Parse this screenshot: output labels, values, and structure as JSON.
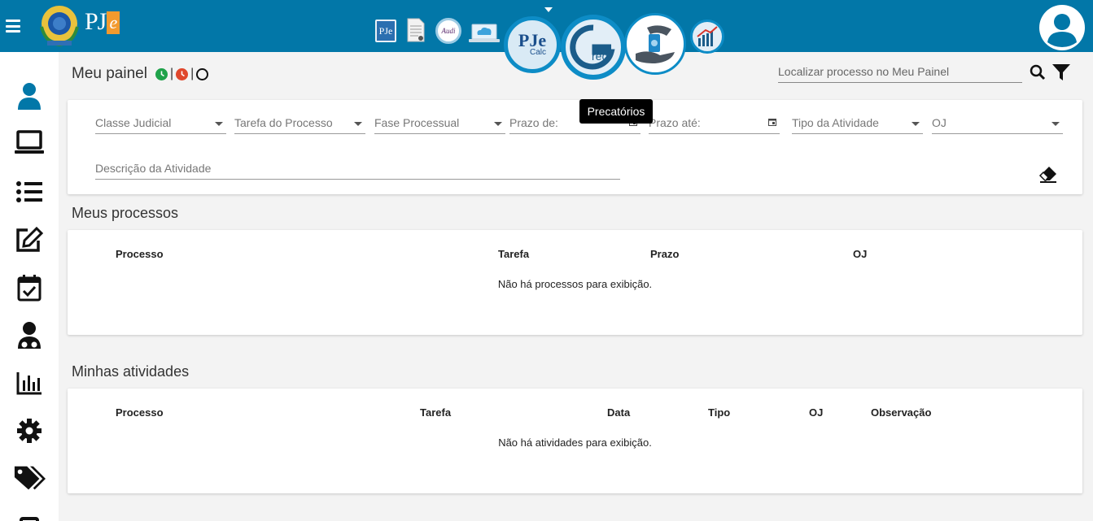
{
  "topbar": {
    "menu_icon": "hamburger-menu-icon",
    "brand_logo": "PJe",
    "apps": [
      {
        "name": "PJe",
        "icon": "pje-app-icon"
      },
      {
        "name": "Document",
        "icon": "document-icon"
      },
      {
        "name": "Audi",
        "icon": "audiencia-icon"
      },
      {
        "name": "Cloud",
        "icon": "cloud-laptop-icon"
      },
      {
        "name": "PJe Calc",
        "label1": "PJe",
        "label2": "Calc",
        "icon": "pje-calc-icon"
      },
      {
        "name": "GPrec",
        "icon": "gprec-icon"
      },
      {
        "name": "Precatórios",
        "icon": "precatorios-icon"
      },
      {
        "name": "Estatística",
        "icon": "runner-chart-icon"
      }
    ],
    "avatar_icon": "user-avatar-icon"
  },
  "sidebar": {
    "items": [
      {
        "icon": "person-icon"
      },
      {
        "icon": "laptop-icon"
      },
      {
        "icon": "list-icon"
      },
      {
        "icon": "edit-icon"
      },
      {
        "icon": "calendar-check-icon"
      },
      {
        "icon": "user-doctor-icon"
      },
      {
        "icon": "bar-chart-icon"
      },
      {
        "icon": "gear-icon"
      },
      {
        "icon": "tags-icon"
      }
    ]
  },
  "header": {
    "title": "Meu painel",
    "separator": "|",
    "search_placeholder": "Localizar processo no Meu Painel"
  },
  "tooltip": {
    "text": "Precatórios"
  },
  "filters": {
    "classe": "Classe Judicial",
    "tarefa": "Tarefa do Processo",
    "fase": "Fase Processual",
    "prazo_de": "Prazo de:",
    "prazo_ate": "Prazo até:",
    "tipo": "Tipo da Atividade",
    "oj": "OJ",
    "descricao": "Descrição da Atividade"
  },
  "meus_processos": {
    "title": "Meus processos",
    "columns": [
      "Processo",
      "Tarefa",
      "Prazo",
      "OJ"
    ],
    "empty_text": "Não há processos para exibição."
  },
  "minhas_atividades": {
    "title": "Minhas atividades",
    "columns": [
      "Processo",
      "Tarefa",
      "Data",
      "Tipo",
      "OJ",
      "Observação"
    ],
    "empty_text": "Não há atividades para exibição."
  },
  "colors": {
    "topbar": "#0277a8",
    "status_green": "#1fa24a",
    "status_red": "#e0472c"
  }
}
